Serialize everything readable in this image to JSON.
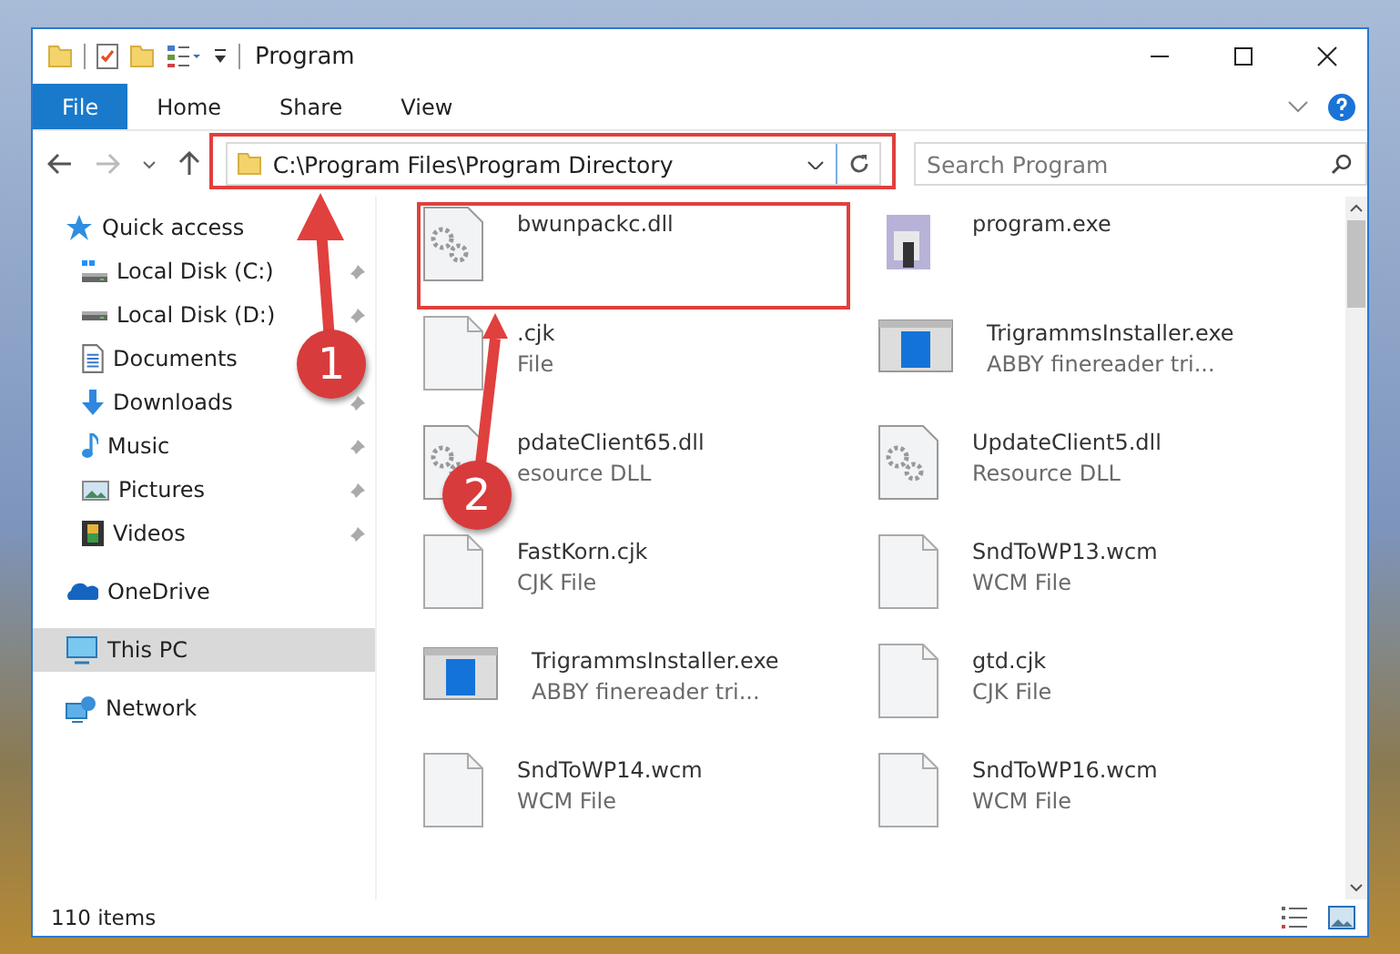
{
  "window": {
    "title": "Program"
  },
  "ribbon_tabs": [
    {
      "label": "File",
      "selected": true
    },
    {
      "label": "Home",
      "selected": false
    },
    {
      "label": "Share",
      "selected": false
    },
    {
      "label": "View",
      "selected": false
    }
  ],
  "address": {
    "value": "C:\\Program Files\\Program Directory"
  },
  "search": {
    "placeholder": "Search Program"
  },
  "sidebar": {
    "items": [
      {
        "label": "Quick access",
        "kind": "star",
        "pinned": false,
        "selected": false,
        "children": [
          {
            "label": "Local Disk (C:)",
            "kind": "disk-c",
            "pinned": true,
            "selected": false
          },
          {
            "label": "Local Disk (D:)",
            "kind": "disk",
            "pinned": true,
            "selected": false
          },
          {
            "label": "Documents",
            "kind": "documents",
            "pinned": false,
            "selected": false
          },
          {
            "label": "Downloads",
            "kind": "downloads",
            "pinned": true,
            "selected": false
          },
          {
            "label": "Music",
            "kind": "music",
            "pinned": true,
            "selected": false
          },
          {
            "label": "Pictures",
            "kind": "pictures",
            "pinned": true,
            "selected": false
          },
          {
            "label": "Videos",
            "kind": "videos",
            "pinned": true,
            "selected": false
          }
        ]
      },
      {
        "label": "OneDrive",
        "kind": "cloud",
        "pinned": false,
        "selected": false
      },
      {
        "label": "This PC",
        "kind": "pc",
        "pinned": false,
        "selected": true
      },
      {
        "label": "Network",
        "kind": "network",
        "pinned": false,
        "selected": false
      }
    ]
  },
  "files": [
    {
      "name": "bwunpackc.dll",
      "kind": "gear-doc"
    },
    {
      "name": "program.exe",
      "kind": "program"
    },
    {
      "name": ".cjk",
      "type": "File",
      "kind": "blank-doc"
    },
    {
      "name": "TrigrammsInstaller.exe",
      "type": "ABBY finereader tri...",
      "kind": "installer"
    },
    {
      "name": "pdateClient65.dll",
      "type": "esource DLL",
      "kind": "gear-doc"
    },
    {
      "name": "UpdateClient5.dll",
      "type": "Resource DLL",
      "kind": "gear-doc"
    },
    {
      "name": "FastKorn.cjk",
      "type": "CJK File",
      "kind": "blank-doc"
    },
    {
      "name": "SndToWP13.wcm",
      "type": "WCM File",
      "kind": "blank-doc"
    },
    {
      "name": "TrigrammsInstaller.exe",
      "type": "ABBY finereader tri...",
      "kind": "installer"
    },
    {
      "name": "gtd.cjk",
      "type": "CJK File",
      "kind": "blank-doc"
    },
    {
      "name": "SndToWP14.wcm",
      "type": "WCM File",
      "kind": "blank-doc"
    },
    {
      "name": "SndToWP16.wcm",
      "type": "WCM File",
      "kind": "blank-doc"
    }
  ],
  "status_bar": {
    "item_count": "110 items"
  },
  "annotations": [
    {
      "number": "1"
    },
    {
      "number": "2"
    }
  ]
}
